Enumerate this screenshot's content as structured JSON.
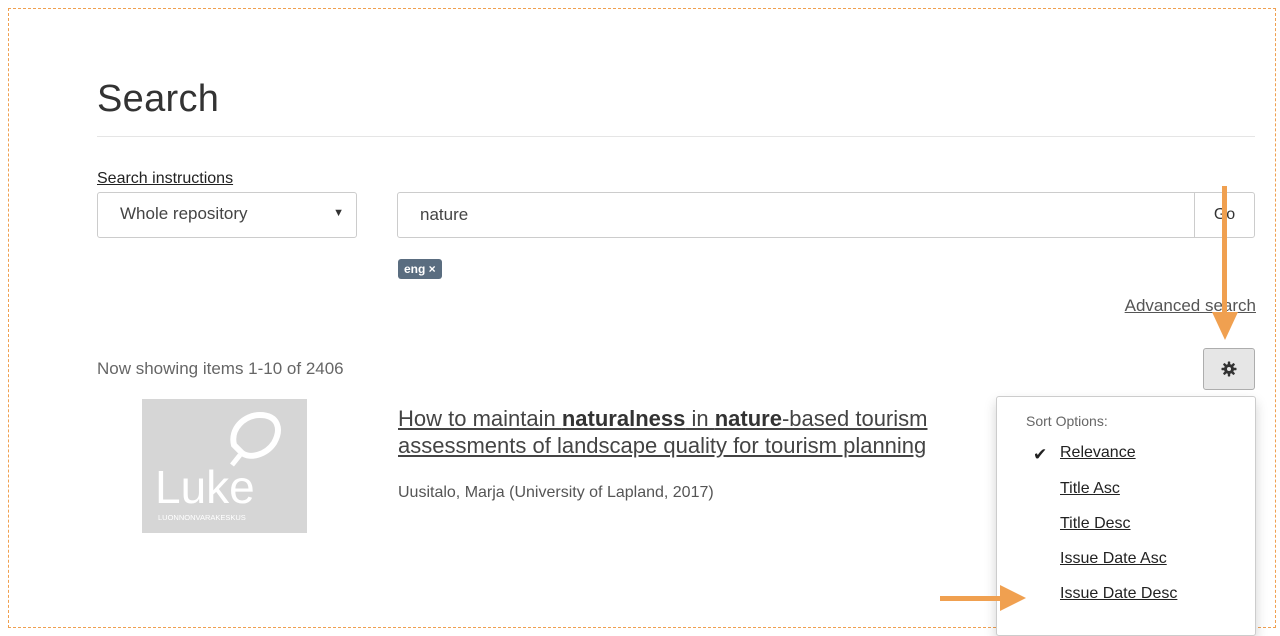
{
  "page_title": "Search",
  "search_instructions": "Search instructions",
  "scope_select": {
    "value": "Whole repository"
  },
  "query_input": {
    "value": "nature"
  },
  "go_button": "Go",
  "filter_badge": "eng ×",
  "advanced_search": "Advanced search",
  "results_count": "Now showing items 1-10 of 2406",
  "result": {
    "title_parts": [
      "How to maintain ",
      "naturalness",
      " in ",
      "nature",
      "-based tourism ",
      "assessments of landscape quality for tourism planning"
    ],
    "meta": "Uusitalo, Marja (University of Lapland, 2017)",
    "thumbnail_logo_text": "Luke",
    "thumbnail_sub_text": "LUONNONVARAKESKUS"
  },
  "sort_menu": {
    "header": "Sort Options:",
    "items": [
      "Relevance",
      "Title Asc",
      "Title Desc",
      "Issue Date Asc",
      "Issue Date Desc"
    ],
    "selected_index": 0
  },
  "icons": {
    "gear": "gear-icon",
    "check": "check-icon",
    "caret": "chevron-down-icon"
  },
  "colors": {
    "annotation_arrow": "#f0a050",
    "badge": "#5a6d80"
  }
}
